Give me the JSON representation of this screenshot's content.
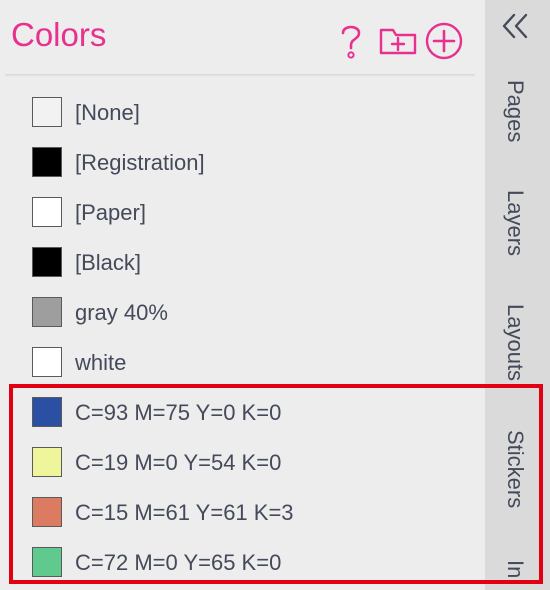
{
  "panel": {
    "title": "Colors",
    "icons": {
      "help": "question-mark-icon",
      "new_group": "folder-plus-icon",
      "add": "circle-plus-icon"
    },
    "accent_color": "#e8318e"
  },
  "swatches": [
    {
      "label": "[None]",
      "color": "#f2f2f2"
    },
    {
      "label": "[Registration]",
      "color": "#000000"
    },
    {
      "label": "[Paper]",
      "color": "#ffffff"
    },
    {
      "label": "[Black]",
      "color": "#000000"
    },
    {
      "label": "gray 40%",
      "color": "#9e9e9e"
    },
    {
      "label": "white",
      "color": "#ffffff"
    },
    {
      "label": "C=93 M=75 Y=0 K=0",
      "color": "#2b4fa3"
    },
    {
      "label": "C=19 M=0 Y=54 K=0",
      "color": "#eef59a"
    },
    {
      "label": "C=15 M=61 Y=61 K=3",
      "color": "#db7b62"
    },
    {
      "label": "C=72 M=0 Y=65 K=0",
      "color": "#5fc98e"
    }
  ],
  "sidebar": {
    "collapse_icon": "double-chevron-left-icon",
    "tabs": [
      "Pages",
      "Layers",
      "Layouts",
      "Stickers",
      "In"
    ]
  },
  "highlight_color": "#e00012"
}
